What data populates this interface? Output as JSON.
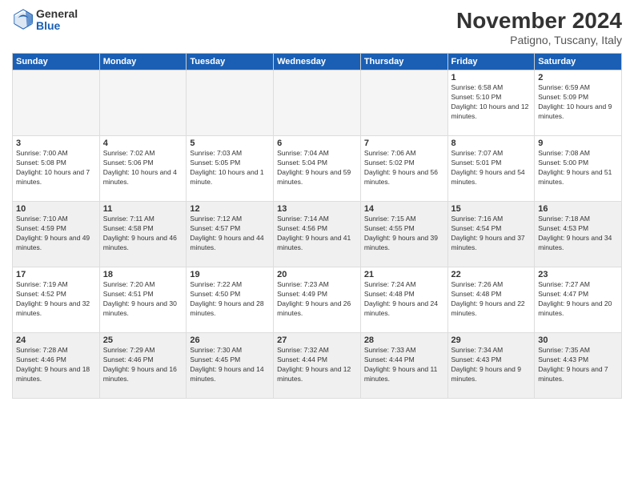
{
  "logo": {
    "general": "General",
    "blue": "Blue"
  },
  "title": "November 2024",
  "location": "Patigno, Tuscany, Italy",
  "headers": [
    "Sunday",
    "Monday",
    "Tuesday",
    "Wednesday",
    "Thursday",
    "Friday",
    "Saturday"
  ],
  "weeks": [
    [
      {
        "day": "",
        "info": "",
        "empty": true
      },
      {
        "day": "",
        "info": "",
        "empty": true
      },
      {
        "day": "",
        "info": "",
        "empty": true
      },
      {
        "day": "",
        "info": "",
        "empty": true
      },
      {
        "day": "",
        "info": "",
        "empty": true
      },
      {
        "day": "1",
        "info": "Sunrise: 6:58 AM\nSunset: 5:10 PM\nDaylight: 10 hours and 12 minutes.",
        "empty": false
      },
      {
        "day": "2",
        "info": "Sunrise: 6:59 AM\nSunset: 5:09 PM\nDaylight: 10 hours and 9 minutes.",
        "empty": false
      }
    ],
    [
      {
        "day": "3",
        "info": "Sunrise: 7:00 AM\nSunset: 5:08 PM\nDaylight: 10 hours and 7 minutes.",
        "empty": false
      },
      {
        "day": "4",
        "info": "Sunrise: 7:02 AM\nSunset: 5:06 PM\nDaylight: 10 hours and 4 minutes.",
        "empty": false
      },
      {
        "day": "5",
        "info": "Sunrise: 7:03 AM\nSunset: 5:05 PM\nDaylight: 10 hours and 1 minute.",
        "empty": false
      },
      {
        "day": "6",
        "info": "Sunrise: 7:04 AM\nSunset: 5:04 PM\nDaylight: 9 hours and 59 minutes.",
        "empty": false
      },
      {
        "day": "7",
        "info": "Sunrise: 7:06 AM\nSunset: 5:02 PM\nDaylight: 9 hours and 56 minutes.",
        "empty": false
      },
      {
        "day": "8",
        "info": "Sunrise: 7:07 AM\nSunset: 5:01 PM\nDaylight: 9 hours and 54 minutes.",
        "empty": false
      },
      {
        "day": "9",
        "info": "Sunrise: 7:08 AM\nSunset: 5:00 PM\nDaylight: 9 hours and 51 minutes.",
        "empty": false
      }
    ],
    [
      {
        "day": "10",
        "info": "Sunrise: 7:10 AM\nSunset: 4:59 PM\nDaylight: 9 hours and 49 minutes.",
        "empty": false
      },
      {
        "day": "11",
        "info": "Sunrise: 7:11 AM\nSunset: 4:58 PM\nDaylight: 9 hours and 46 minutes.",
        "empty": false
      },
      {
        "day": "12",
        "info": "Sunrise: 7:12 AM\nSunset: 4:57 PM\nDaylight: 9 hours and 44 minutes.",
        "empty": false
      },
      {
        "day": "13",
        "info": "Sunrise: 7:14 AM\nSunset: 4:56 PM\nDaylight: 9 hours and 41 minutes.",
        "empty": false
      },
      {
        "day": "14",
        "info": "Sunrise: 7:15 AM\nSunset: 4:55 PM\nDaylight: 9 hours and 39 minutes.",
        "empty": false
      },
      {
        "day": "15",
        "info": "Sunrise: 7:16 AM\nSunset: 4:54 PM\nDaylight: 9 hours and 37 minutes.",
        "empty": false
      },
      {
        "day": "16",
        "info": "Sunrise: 7:18 AM\nSunset: 4:53 PM\nDaylight: 9 hours and 34 minutes.",
        "empty": false
      }
    ],
    [
      {
        "day": "17",
        "info": "Sunrise: 7:19 AM\nSunset: 4:52 PM\nDaylight: 9 hours and 32 minutes.",
        "empty": false
      },
      {
        "day": "18",
        "info": "Sunrise: 7:20 AM\nSunset: 4:51 PM\nDaylight: 9 hours and 30 minutes.",
        "empty": false
      },
      {
        "day": "19",
        "info": "Sunrise: 7:22 AM\nSunset: 4:50 PM\nDaylight: 9 hours and 28 minutes.",
        "empty": false
      },
      {
        "day": "20",
        "info": "Sunrise: 7:23 AM\nSunset: 4:49 PM\nDaylight: 9 hours and 26 minutes.",
        "empty": false
      },
      {
        "day": "21",
        "info": "Sunrise: 7:24 AM\nSunset: 4:48 PM\nDaylight: 9 hours and 24 minutes.",
        "empty": false
      },
      {
        "day": "22",
        "info": "Sunrise: 7:26 AM\nSunset: 4:48 PM\nDaylight: 9 hours and 22 minutes.",
        "empty": false
      },
      {
        "day": "23",
        "info": "Sunrise: 7:27 AM\nSunset: 4:47 PM\nDaylight: 9 hours and 20 minutes.",
        "empty": false
      }
    ],
    [
      {
        "day": "24",
        "info": "Sunrise: 7:28 AM\nSunset: 4:46 PM\nDaylight: 9 hours and 18 minutes.",
        "empty": false
      },
      {
        "day": "25",
        "info": "Sunrise: 7:29 AM\nSunset: 4:46 PM\nDaylight: 9 hours and 16 minutes.",
        "empty": false
      },
      {
        "day": "26",
        "info": "Sunrise: 7:30 AM\nSunset: 4:45 PM\nDaylight: 9 hours and 14 minutes.",
        "empty": false
      },
      {
        "day": "27",
        "info": "Sunrise: 7:32 AM\nSunset: 4:44 PM\nDaylight: 9 hours and 12 minutes.",
        "empty": false
      },
      {
        "day": "28",
        "info": "Sunrise: 7:33 AM\nSunset: 4:44 PM\nDaylight: 9 hours and 11 minutes.",
        "empty": false
      },
      {
        "day": "29",
        "info": "Sunrise: 7:34 AM\nSunset: 4:43 PM\nDaylight: 9 hours and 9 minutes.",
        "empty": false
      },
      {
        "day": "30",
        "info": "Sunrise: 7:35 AM\nSunset: 4:43 PM\nDaylight: 9 hours and 7 minutes.",
        "empty": false
      }
    ]
  ]
}
